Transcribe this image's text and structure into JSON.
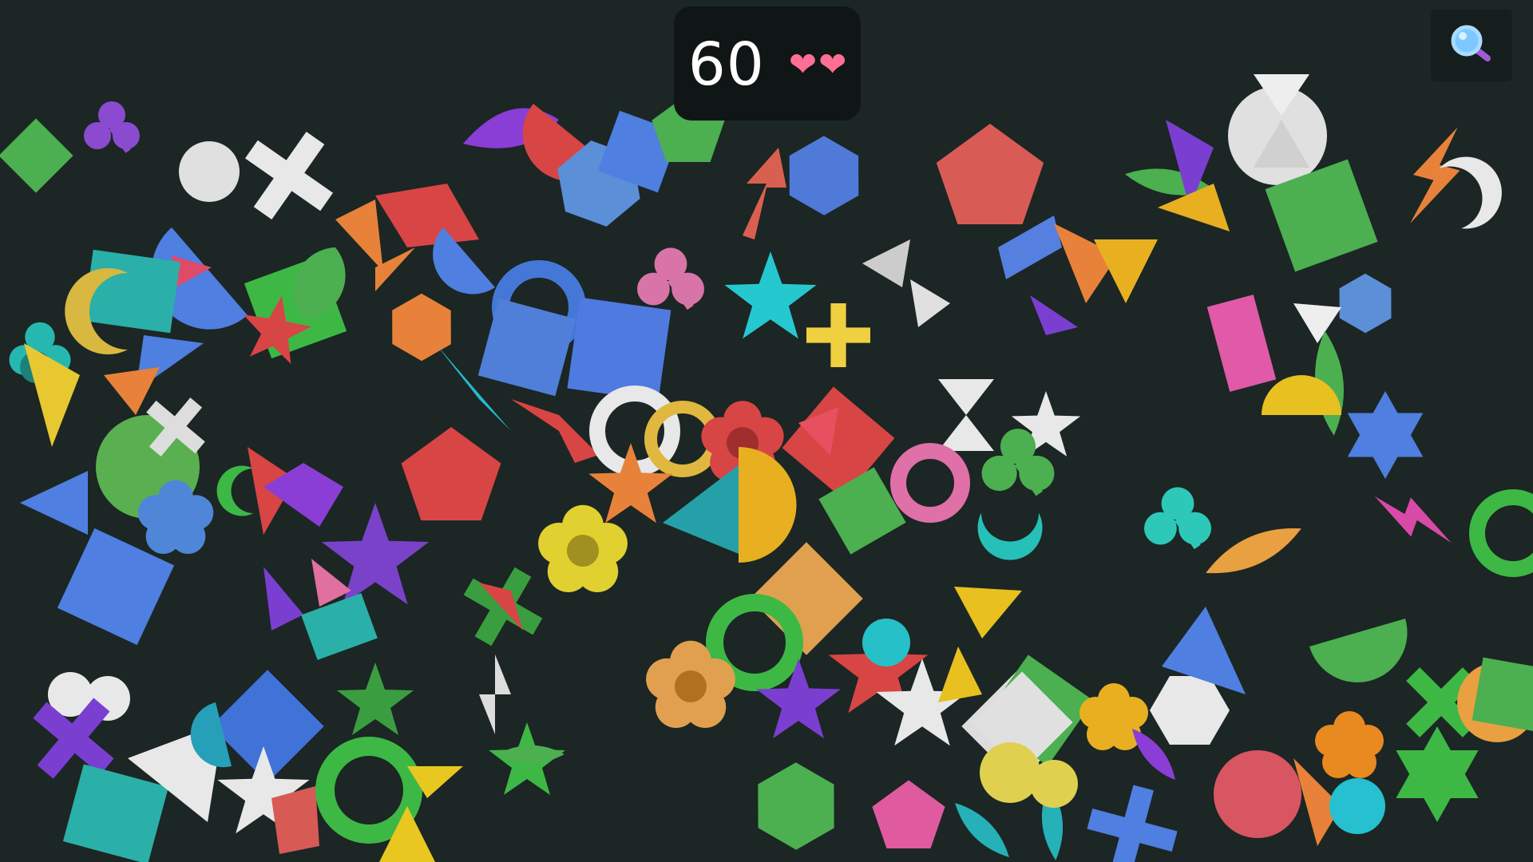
{
  "hud": {
    "timer": "60",
    "lives": [
      "❤",
      "❤"
    ]
  },
  "zoom_button": {
    "icon": "magnifier-icon"
  },
  "palette": {
    "background": "#1c2624",
    "hud_background": "#101615",
    "heart": "#ff6f95"
  }
}
